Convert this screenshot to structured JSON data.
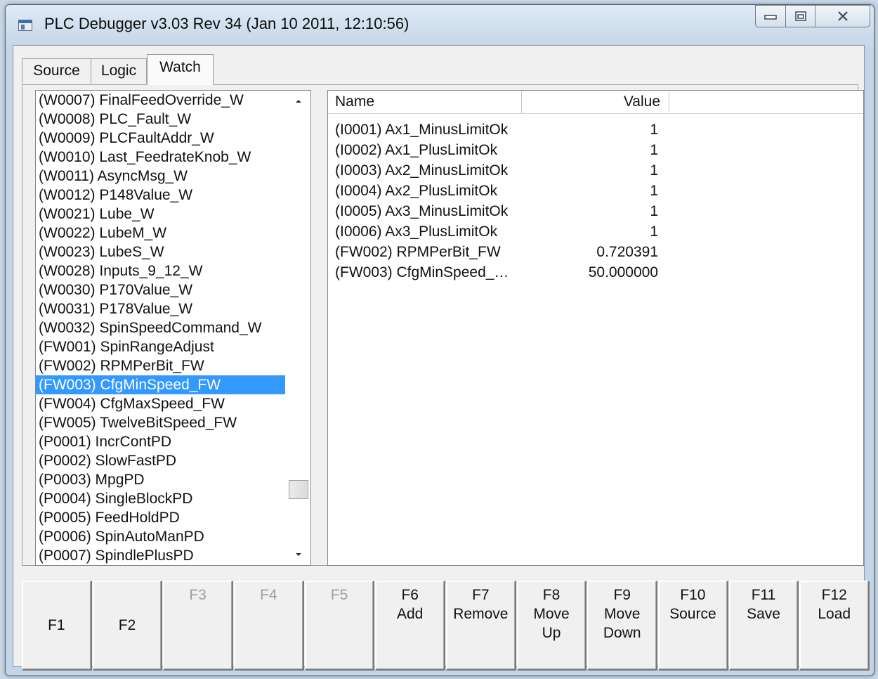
{
  "window": {
    "title": "PLC Debugger v3.03 Rev 34 (Jan 10 2011, 12:10:56)"
  },
  "tabs": [
    {
      "label": "Source"
    },
    {
      "label": "Logic"
    },
    {
      "label": "Watch",
      "active": true
    }
  ],
  "variable_list": {
    "items": [
      "(W0007) FinalFeedOverride_W",
      "(W0008) PLC_Fault_W",
      "(W0009) PLCFaultAddr_W",
      "(W0010) Last_FeedrateKnob_W",
      "(W0011) AsyncMsg_W",
      "(W0012) P148Value_W",
      "(W0021) Lube_W",
      "(W0022) LubeM_W",
      "(W0023) LubeS_W",
      "(W0028) Inputs_9_12_W",
      "(W0030) P170Value_W",
      "(W0031) P178Value_W",
      "(W0032) SpinSpeedCommand_W",
      "(FW001) SpinRangeAdjust",
      "(FW002) RPMPerBit_FW",
      "(FW003) CfgMinSpeed_FW",
      "(FW004) CfgMaxSpeed_FW",
      "(FW005) TwelveBitSpeed_FW",
      "(P0001) IncrContPD",
      "(P0002) SlowFastPD",
      "(P0003) MpgPD",
      "(P0004) SingleBlockPD",
      "(P0005) FeedHoldPD",
      "(P0006) SpinAutoManPD",
      "(P0007) SpindlePlusPD"
    ],
    "selected": "(FW003) CfgMinSpeed_FW"
  },
  "watch_table": {
    "columns": [
      "Name",
      "Value",
      ""
    ],
    "rows": [
      {
        "name": "(I0001) Ax1_MinusLimitOk",
        "value": "1"
      },
      {
        "name": "(I0002) Ax1_PlusLimitOk",
        "value": "1"
      },
      {
        "name": "(I0003) Ax2_MinusLimitOk",
        "value": "1"
      },
      {
        "name": "(I0004) Ax2_PlusLimitOk",
        "value": "1"
      },
      {
        "name": "(I0005) Ax3_MinusLimitOk",
        "value": "1"
      },
      {
        "name": "(I0006) Ax3_PlusLimitOk",
        "value": "1"
      },
      {
        "name": "(FW002) RPMPerBit_FW",
        "value": "0.720391"
      },
      {
        "name": "(FW003) CfgMinSpeed_…",
        "value": "50.000000"
      }
    ]
  },
  "function_keys": [
    {
      "lines": [
        "F1"
      ],
      "enabled": true,
      "single": true
    },
    {
      "lines": [
        "F2"
      ],
      "enabled": true,
      "single": true
    },
    {
      "lines": [
        "F3"
      ],
      "enabled": false
    },
    {
      "lines": [
        "F4"
      ],
      "enabled": false
    },
    {
      "lines": [
        "F5"
      ],
      "enabled": false
    },
    {
      "lines": [
        "F6",
        "Add"
      ],
      "enabled": true
    },
    {
      "lines": [
        "F7",
        "Remove"
      ],
      "enabled": true
    },
    {
      "lines": [
        "F8",
        "Move",
        "Up"
      ],
      "enabled": true
    },
    {
      "lines": [
        "F9",
        "Move",
        "Down"
      ],
      "enabled": true
    },
    {
      "lines": [
        "F10",
        "Source"
      ],
      "enabled": true
    },
    {
      "lines": [
        "F11",
        "Save"
      ],
      "enabled": true
    },
    {
      "lines": [
        "F12",
        "Load"
      ],
      "enabled": true
    }
  ],
  "icons": {
    "app": "app-window-icon",
    "minimize": "minimize-icon",
    "maximize": "maximize-icon",
    "close": "close-icon",
    "scroll_up": "scroll-up-arrow-icon",
    "scroll_down": "scroll-down-arrow-icon"
  },
  "colors": {
    "selection": "#3399ff",
    "window_frame": "#c4d5e8",
    "client_bg": "#f0f0f0",
    "disabled_text": "#9f9f9f"
  }
}
